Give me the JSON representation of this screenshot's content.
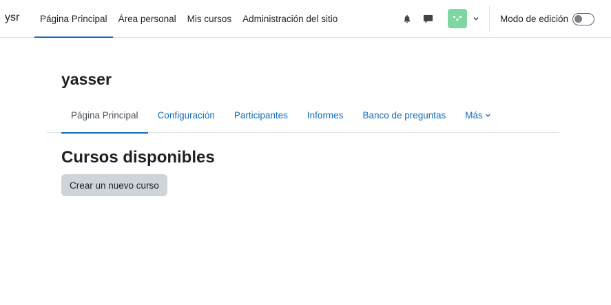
{
  "navbar": {
    "brand": "ysr",
    "primary_nav": [
      {
        "label": "Página Principal",
        "active": true
      },
      {
        "label": "Área personal",
        "active": false
      },
      {
        "label": "Mis cursos",
        "active": false
      },
      {
        "label": "Administración del sitio",
        "active": false
      }
    ],
    "icons": [
      "bell-icon",
      "message-icon"
    ],
    "user_menu": {
      "avatar_color": "#7ed6a3",
      "icon": "chevron-down-icon"
    },
    "edit_mode": {
      "label": "Modo de edición",
      "enabled": false
    }
  },
  "page": {
    "title": "yasser",
    "secondary_nav": [
      {
        "label": "Página Principal",
        "active": true
      },
      {
        "label": "Configuración",
        "active": false
      },
      {
        "label": "Participantes",
        "active": false
      },
      {
        "label": "Informes",
        "active": false
      },
      {
        "label": "Banco de preguntas",
        "active": false
      },
      {
        "label": "Más",
        "active": false
      }
    ]
  },
  "main": {
    "heading": "Cursos disponibles",
    "create_button": "Crear un nuevo curso"
  },
  "colors": {
    "accent": "#0f6cbf",
    "button_bg": "#ced4da",
    "text": "#1d2125"
  }
}
